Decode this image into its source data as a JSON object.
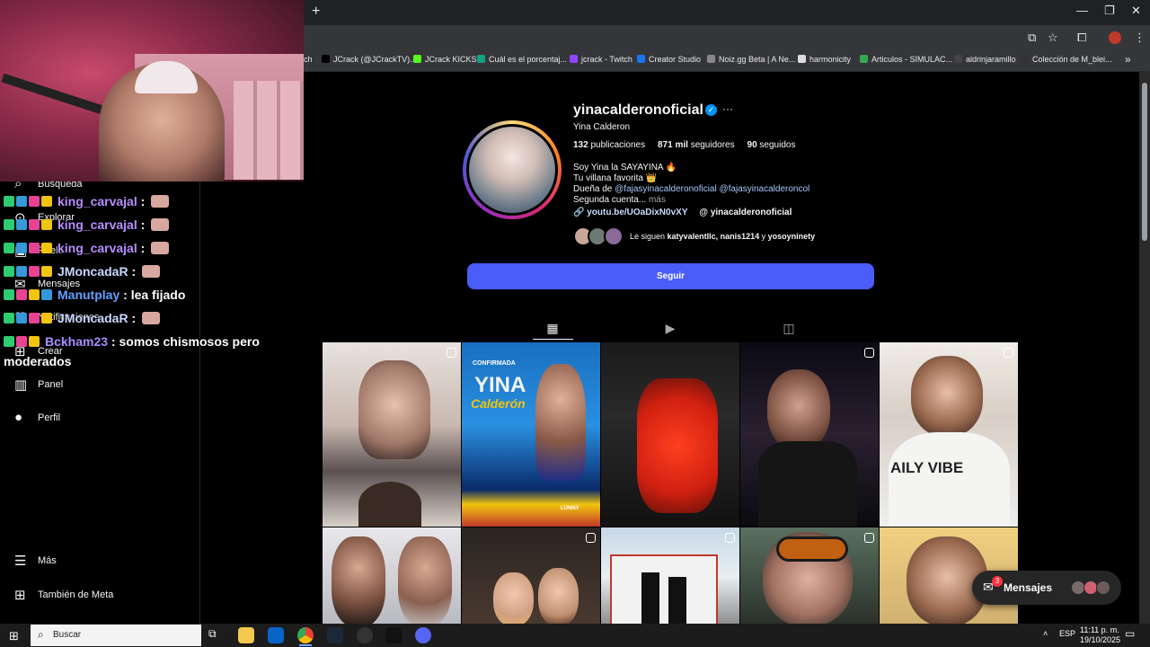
{
  "browser": {
    "new_tab": "+",
    "window_controls": {
      "minimize": "—",
      "maximize": "❐",
      "close": "✕"
    },
    "bookmarks": [
      {
        "label": "ch",
        "color": "#555"
      },
      {
        "label": "JCrack (@JCrackTV)...",
        "color": "#000"
      },
      {
        "label": "JCrack KICKS",
        "color": "#53fc18"
      },
      {
        "label": "Cuál es el porcentaj...",
        "color": "#10a37f"
      },
      {
        "label": "jcrack - Twitch",
        "color": "#9146ff"
      },
      {
        "label": "Creator Studio",
        "color": "#1877f2"
      },
      {
        "label": "Noiz.gg Beta | A Ne...",
        "color": "#888"
      },
      {
        "label": "harmonicity",
        "color": "#ddd"
      },
      {
        "label": "Articulos - SIMULAC...",
        "color": "#34a853"
      },
      {
        "label": "aldrinjaramillo",
        "color": "#444"
      },
      {
        "label": "Colección de M_blei...",
        "color": "#333"
      }
    ],
    "bookmarks_more": "»"
  },
  "ig_nav": [
    {
      "label": "Búsqueda",
      "icon": "search-icon",
      "glyph": "⌕"
    },
    {
      "label": "Explorar",
      "icon": "compass-icon",
      "glyph": "⊙"
    },
    {
      "label": "Reels",
      "icon": "reels-icon",
      "glyph": "▣"
    },
    {
      "label": "Mensajes",
      "icon": "messages-icon",
      "glyph": "✉"
    },
    {
      "label": "Notificaciones",
      "icon": "heart-icon",
      "glyph": "♡"
    },
    {
      "label": "Crear",
      "icon": "plus-icon",
      "glyph": "⊞"
    },
    {
      "label": "Panel",
      "icon": "chart-icon",
      "glyph": "▥"
    },
    {
      "label": "Perfil",
      "icon": "avatar-icon",
      "glyph": "●"
    },
    {
      "label": "Más",
      "icon": "menu-icon",
      "glyph": "☰"
    },
    {
      "label": "También de Meta",
      "icon": "meta-icon",
      "glyph": "⊞"
    }
  ],
  "chat": [
    {
      "user": "king_carvajal",
      "sep": " : ",
      "msg": "",
      "color": "#b78dff",
      "emote": true
    },
    {
      "user": "king_carvajal",
      "sep": " : ",
      "msg": "",
      "color": "#b78dff",
      "emote": true
    },
    {
      "user": "king_carvajal",
      "sep": " : ",
      "msg": "",
      "color": "#b78dff",
      "emote": true
    },
    {
      "user": "JMoncadaR",
      "sep": " : ",
      "msg": "",
      "color": "#c9d7ff",
      "emote": true
    },
    {
      "user": "Manutplay",
      "sep": " : ",
      "msg": "lea fijado",
      "color": "#5fa0ff",
      "emote": false
    },
    {
      "user": "JMoncadaR",
      "sep": " : ",
      "msg": "",
      "color": "#c9d7ff",
      "emote": true
    },
    {
      "user": "Bckham23",
      "sep": " : ",
      "msg": "somos chismosos pero",
      "color": "#a98cff",
      "emote": false
    }
  ],
  "chat_wrap": "moderados",
  "profile": {
    "username": "yinacalderonoficial",
    "verified": "✓",
    "more": "···",
    "full_name": "Yina Calderon",
    "posts_count": "132",
    "posts_label": "publicaciones",
    "followers_count": "871 mil",
    "followers_label": "seguidores",
    "following_count": "90",
    "following_label": "seguidos",
    "bio": {
      "line1": "Soy Yina la SAYAYINA 🔥",
      "line2": "Tu villana favorita 👑",
      "line3_prefix": "Dueña de ",
      "line3_link1": "@fajasyinacalderonoficial",
      "line3_link2": "@fajasyinacalderoncol",
      "line4": "Segunda cuenta...",
      "more": "más"
    },
    "link": "youtube/UOaDixN0vXY",
    "link_display": "youtu.be/UOaDixN0vXY",
    "threads": "yinacalderonoficial",
    "followed_by_prefix": "Le siguen ",
    "followed_by_names": "katyvalentllc, nanis1214",
    "followed_by_and": " y ",
    "followed_by_last": "yosoyninety",
    "follow_button": "Seguir"
  },
  "tabs": [
    {
      "name": "tab-posts",
      "glyph": "▦",
      "active": true
    },
    {
      "name": "tab-reels",
      "glyph": "▶",
      "active": false
    },
    {
      "name": "tab-tagged",
      "glyph": "◫",
      "active": false
    }
  ],
  "grid_text": {
    "confirmada": "CONFIRMADA",
    "yina": "YINA",
    "calderon": "Calderón",
    "daily": "AILY VIBE",
    "lunny": "LUNNY"
  },
  "messages_pill": {
    "label": "Mensajes",
    "count": "3"
  },
  "taskbar": {
    "search": "Buscar",
    "lang": "ESP",
    "time": "11:11 p. m.",
    "date": "19/10/2025"
  }
}
